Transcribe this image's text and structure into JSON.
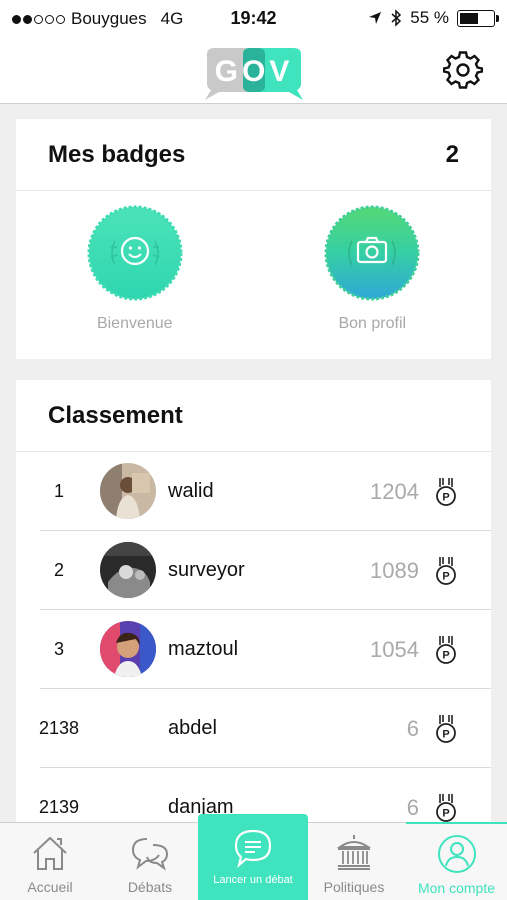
{
  "status_bar": {
    "carrier": "Bouygues",
    "network": "4G",
    "time": "19:42",
    "battery": "55 %",
    "battery_level": 0.55,
    "signal_bars": 2,
    "icons": [
      "location-arrow-icon",
      "bluetooth-icon",
      "battery-icon"
    ]
  },
  "header": {
    "logo_text": "GOV",
    "settings_icon": "gear-icon"
  },
  "badges": {
    "title": "Mes badges",
    "count": "2",
    "items": [
      {
        "label": "Bienvenue",
        "icon": "smiley-icon"
      },
      {
        "label": "Bon profil",
        "icon": "camera-icon"
      }
    ]
  },
  "ranking": {
    "title": "Classement",
    "rows": [
      {
        "rank": "1",
        "name": "walid",
        "score": "1204",
        "has_avatar": true
      },
      {
        "rank": "2",
        "name": "surveyor",
        "score": "1089",
        "has_avatar": true
      },
      {
        "rank": "3",
        "name": "maztoul",
        "score": "1054",
        "has_avatar": true
      },
      {
        "rank": "2138",
        "name": "abdel",
        "score": "6",
        "has_avatar": false
      },
      {
        "rank": "2139",
        "name": "danjam",
        "score": "6",
        "has_avatar": false
      }
    ]
  },
  "tabbar": {
    "tabs": [
      {
        "label": "Accueil",
        "icon": "home-icon"
      },
      {
        "label": "Débats",
        "icon": "chat-bubbles-icon"
      },
      {
        "label": "Lancer un débat",
        "icon": "chat-bubble-icon"
      },
      {
        "label": "Politiques",
        "icon": "building-icon"
      },
      {
        "label": "Mon compte",
        "icon": "user-icon",
        "active": true
      }
    ]
  },
  "colors": {
    "accent": "#3fe3bd",
    "muted_text": "#a9a9a9"
  }
}
